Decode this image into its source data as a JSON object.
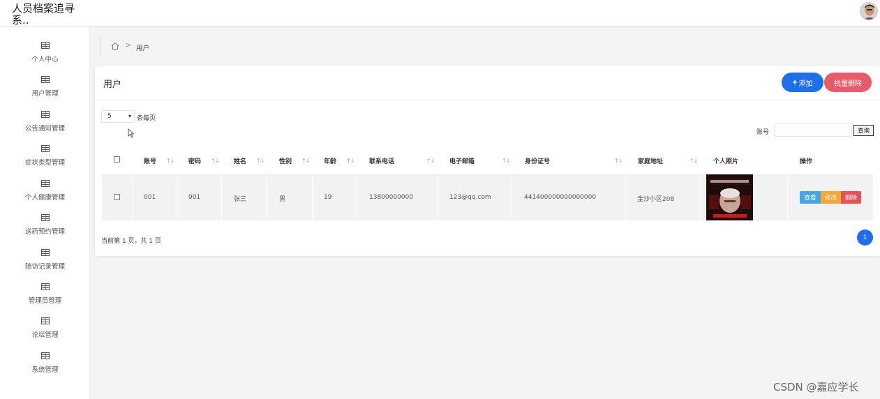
{
  "app": {
    "title_line1": "",
    "title": "人员档案追寻系.."
  },
  "sidebar": {
    "items": [
      {
        "label": "个人中心"
      },
      {
        "label": "用户管理"
      },
      {
        "label": "公告通知管理"
      },
      {
        "label": "症状类型管理"
      },
      {
        "label": "个人健康管理"
      },
      {
        "label": "送药预约管理"
      },
      {
        "label": "随访记录管理"
      },
      {
        "label": "管理员管理"
      },
      {
        "label": "论坛管理"
      },
      {
        "label": "系统管理"
      }
    ]
  },
  "breadcrumb": {
    "current": "用户",
    "separator": ">"
  },
  "card": {
    "title": "用户",
    "add_label": "添加",
    "add_icon": "+",
    "batch_delete_label": "批量删除",
    "page_size": "5",
    "per_page_label": "条每页",
    "search_label": "账号",
    "search_button": "查询"
  },
  "table": {
    "columns": [
      "账号",
      "密码",
      "姓名",
      "性别",
      "年龄",
      "联系电话",
      "电子邮箱",
      "身份证号",
      "家庭地址",
      "个人照片",
      "操作"
    ],
    "sort_icon": "↑↓",
    "rows": [
      {
        "account": "001",
        "password": "001",
        "name": "张三",
        "gender": "男",
        "age": "19",
        "phone": "13800000000",
        "email": "123@qq.com",
        "id_number": "441400000000000000",
        "address": "金沙小区208"
      }
    ],
    "actions": {
      "view": "查看",
      "edit": "修改",
      "delete": "删除"
    }
  },
  "pagination": {
    "info": "当前第 1 页，共 1 页",
    "current": "1"
  },
  "watermark": "CSDN @嘉应学长",
  "colors": {
    "primary": "#1f6fe8",
    "danger": "#e85c6a",
    "view": "#44a6e8",
    "edit": "#f3a73a",
    "delete": "#e8505b"
  }
}
